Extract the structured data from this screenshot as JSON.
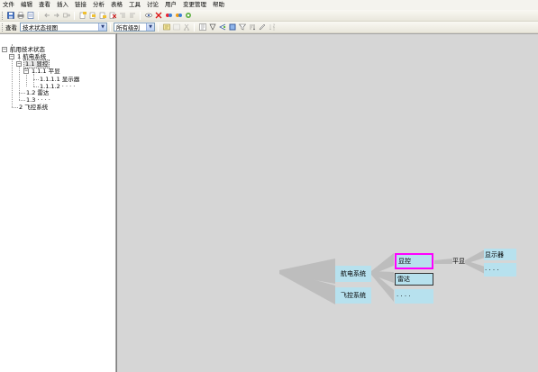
{
  "menu": [
    "文件",
    "编辑",
    "查看",
    "插入",
    "链接",
    "分析",
    "表格",
    "工具",
    "讨论",
    "用户",
    "变更管理",
    "帮助"
  ],
  "toolbar2": {
    "view_label": "查看",
    "view_select": "技术状态视图",
    "level_select": "所有级别"
  },
  "tree": {
    "root": "航用技术状态",
    "n1": "1 航电系统",
    "n11": "1.1 显控",
    "n111": "1.1.1 平显",
    "n1111": "1.1.1.1 显示器",
    "n1112": "1.1.1.2 · · · ·",
    "n12": "1.2 雷达",
    "n13": "1.3 · · · ·",
    "n2": "2 飞控系统"
  },
  "map": {
    "hangdian": "航电系统",
    "feikong": "飞控系统",
    "xiankong": "显控",
    "leida": "雷达",
    "dots_mid": "· · · ·",
    "pingxian": "平显",
    "xianshiqi": "显示器",
    "dots_right": "· · · ·"
  },
  "colors": {
    "node_fill": "#b7e1ee",
    "selection_border": "#ff00ff",
    "canvas_bg": "#d6d6d6"
  }
}
